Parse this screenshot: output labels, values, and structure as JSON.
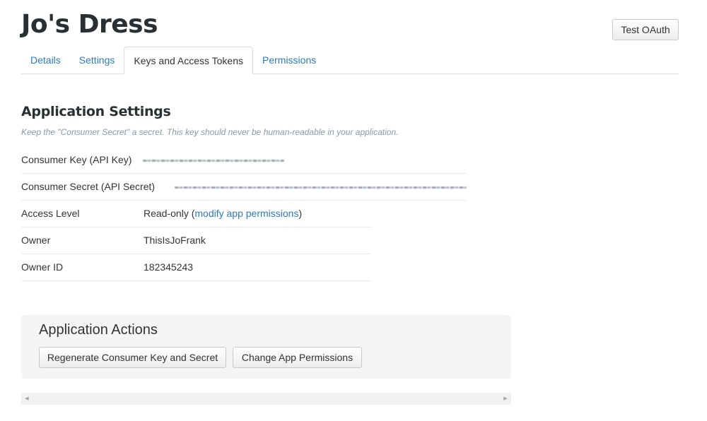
{
  "app": {
    "title": "Jo's Dress"
  },
  "header": {
    "test_oauth_label": "Test OAuth"
  },
  "tabs": [
    {
      "label": "Details",
      "active": false
    },
    {
      "label": "Settings",
      "active": false
    },
    {
      "label": "Keys and Access Tokens",
      "active": true
    },
    {
      "label": "Permissions",
      "active": false
    }
  ],
  "application_settings": {
    "title": "Application Settings",
    "hint": "Keep the \"Consumer Secret\" a secret. This key should never be human-readable in your application.",
    "consumer_key": {
      "label": "Consumer Key (API Key)",
      "redacted": true
    },
    "consumer_secret": {
      "label": "Consumer Secret (API Secret)",
      "redacted": true
    },
    "access_level": {
      "label": "Access Level",
      "value": "Read-only",
      "paren_open": " (",
      "link_text": "modify app permissions",
      "paren_close": ")"
    },
    "owner": {
      "label": "Owner",
      "value": "ThisIsJoFrank"
    },
    "owner_id": {
      "label": "Owner ID",
      "value": "182345243"
    }
  },
  "application_actions": {
    "title": "Application Actions",
    "regenerate_label": "Regenerate Consumer Key and Secret",
    "change_permissions_label": "Change App Permissions"
  },
  "scrollbar": {
    "left_arrow": "◀",
    "right_arrow": "▶"
  },
  "colors": {
    "link": "#2b7bb9",
    "title": "#292f33",
    "hint": "#8899a6",
    "panel_bg": "#f5f5f5",
    "divider": "#e6ecf0"
  }
}
